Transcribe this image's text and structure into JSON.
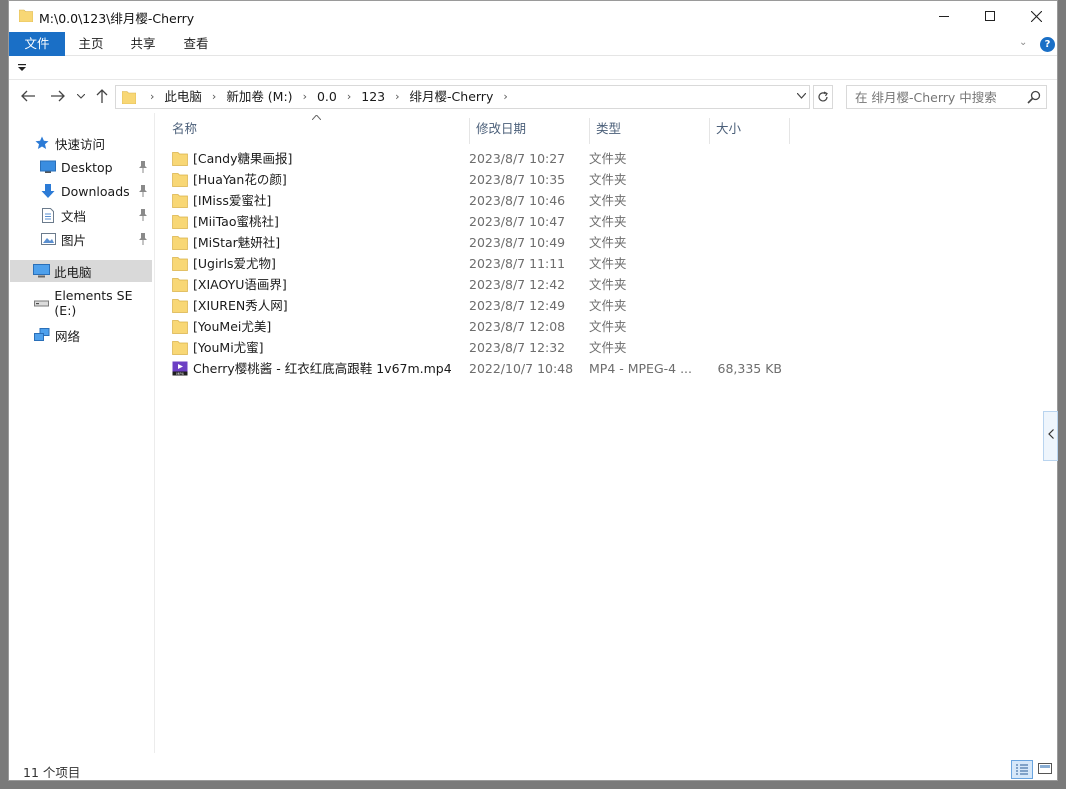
{
  "window": {
    "title": "M:\\0.0\\123\\绯月樱-Cherry"
  },
  "ribbon": {
    "tabs": [
      {
        "label": "文件"
      },
      {
        "label": "主页"
      },
      {
        "label": "共享"
      },
      {
        "label": "查看"
      }
    ],
    "accent": "#1a6fc6"
  },
  "address": {
    "crumbs": [
      "此电脑",
      "新加卷 (M:)",
      "0.0",
      "123",
      "绯月樱-Cherry"
    ]
  },
  "search": {
    "placeholder": "在 绯月樱-Cherry 中搜索"
  },
  "nav": {
    "quick_access": "快速访问",
    "items": [
      {
        "label": "Desktop"
      },
      {
        "label": "Downloads"
      },
      {
        "label": "文档"
      },
      {
        "label": "图片"
      }
    ],
    "this_pc": "此电脑",
    "drive": "Elements SE (E:)",
    "network": "网络"
  },
  "columns": {
    "name": "名称",
    "date": "修改日期",
    "type": "类型",
    "size": "大小"
  },
  "files": [
    {
      "name": "[Candy糖果画报]",
      "date": "2023/8/7 10:27",
      "type": "文件夹",
      "size": "",
      "icon": "folder-icon"
    },
    {
      "name": "[HuaYan花の颜]",
      "date": "2023/8/7 10:35",
      "type": "文件夹",
      "size": "",
      "icon": "folder-icon"
    },
    {
      "name": "[IMiss爱蜜社]",
      "date": "2023/8/7 10:46",
      "type": "文件夹",
      "size": "",
      "icon": "folder-icon"
    },
    {
      "name": "[MiiTao蜜桃社]",
      "date": "2023/8/7 10:47",
      "type": "文件夹",
      "size": "",
      "icon": "folder-icon"
    },
    {
      "name": "[MiStar魅妍社]",
      "date": "2023/8/7 10:49",
      "type": "文件夹",
      "size": "",
      "icon": "folder-icon"
    },
    {
      "name": "[Ugirls爱尤物]",
      "date": "2023/8/7 11:11",
      "type": "文件夹",
      "size": "",
      "icon": "folder-icon"
    },
    {
      "name": "[XIAOYU语画界]",
      "date": "2023/8/7 12:42",
      "type": "文件夹",
      "size": "",
      "icon": "folder-icon"
    },
    {
      "name": "[XIUREN秀人网]",
      "date": "2023/8/7 12:49",
      "type": "文件夹",
      "size": "",
      "icon": "folder-icon"
    },
    {
      "name": "[YouMei尤美]",
      "date": "2023/8/7 12:08",
      "type": "文件夹",
      "size": "",
      "icon": "folder-icon"
    },
    {
      "name": "[YouMi尤蜜]",
      "date": "2023/8/7 12:32",
      "type": "文件夹",
      "size": "",
      "icon": "folder-icon"
    },
    {
      "name": "Cherry樱桃酱 - 红衣红底高跟鞋 1v67m.mp4",
      "date": "2022/10/7 10:48",
      "type": "MP4 - MPEG-4 ...",
      "size": "68,335 KB",
      "icon": "mp4-file-icon"
    }
  ],
  "status": {
    "item_count": "11 个项目"
  }
}
